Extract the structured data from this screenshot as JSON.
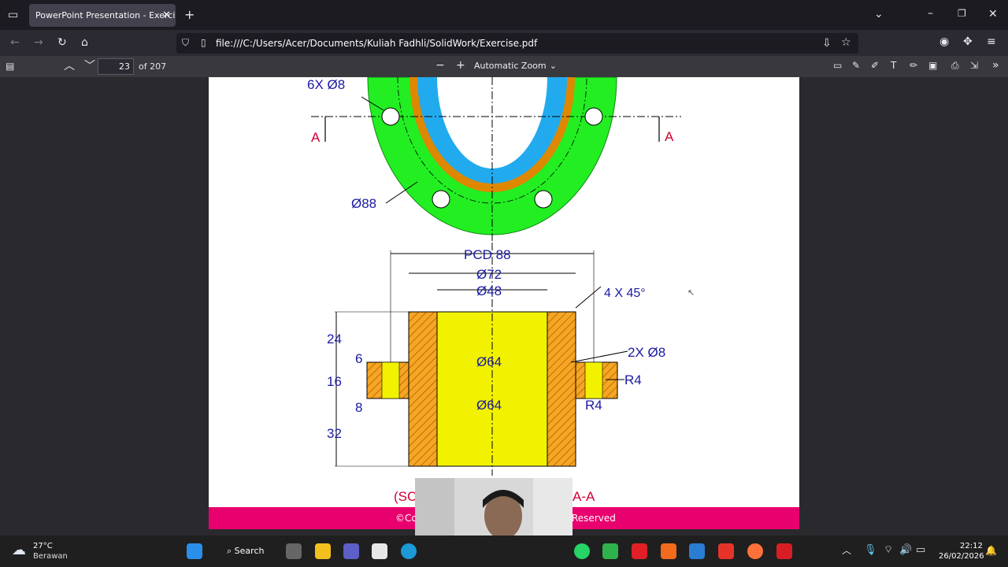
{
  "browser": {
    "tab_title": "PowerPoint Presentation - Exercise.pdf",
    "url": "file:///C:/Users/Acer/Documents/Kuliah Fadhli/SolidWork/Exercise.pdf"
  },
  "pdf_toolbar": {
    "page_number": "23",
    "page_total": "of 207",
    "zoom": "Automatic Zoom"
  },
  "drawing": {
    "label_6x8": "6X Ø8",
    "label_a_left": "A",
    "label_a_right": "A",
    "label_88": "Ø88",
    "label_pcd": "PCD 88",
    "label_72": "Ø72",
    "label_48": "Ø48",
    "label_chamfer": "4 X 45°",
    "label_2x8": "2X Ø8",
    "label_r4_a": "R4",
    "label_r4_b": "R4",
    "label_64_a": "Ø64",
    "label_64_b": "Ø64",
    "dim_24": "24",
    "dim_6": "6",
    "dim_16": "16",
    "dim_8": "8",
    "dim_32": "32",
    "section_left": "(SC",
    "section_right": "A-A",
    "footer_left": "©Co",
    "footer_right": "Reserved"
  },
  "taskbar": {
    "weather_temp": "27°C",
    "weather_desc": "Berawan",
    "search": "Search",
    "time": "22:12",
    "date": "26/02/2026"
  },
  "colors": {
    "green": "#22ee22",
    "blue": "#22aaee",
    "orange": "#dd8800",
    "yellow": "#f2f200",
    "hatch": "#f5a623",
    "dim": "#1a1aa0",
    "red": "#cc0033",
    "footer": "#e8006e"
  }
}
